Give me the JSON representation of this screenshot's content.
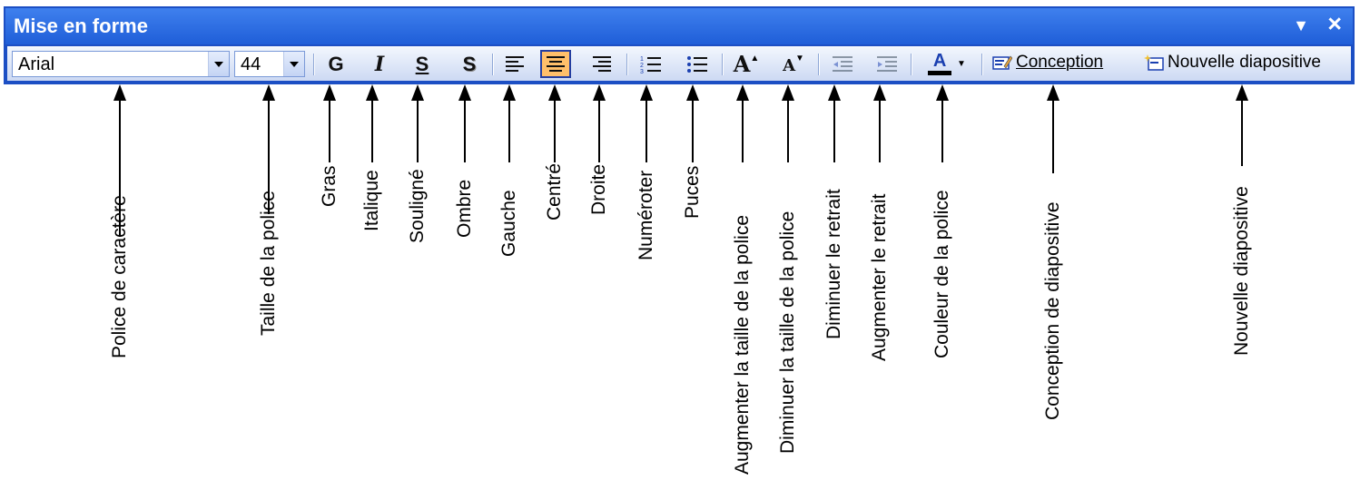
{
  "window": {
    "title": "Mise en forme"
  },
  "toolbar": {
    "font_value": "Arial",
    "size_value": "44",
    "bold_glyph": "G",
    "italic_glyph": "I",
    "underline_glyph": "S",
    "shadow_glyph": "S",
    "grow_glyph": "A",
    "shrink_glyph": "A",
    "color_glyph": "A",
    "color_bar": "#000000",
    "conception_label": "Conception",
    "new_slide_label": "Nouvelle diapositive",
    "active_button": "align-center"
  },
  "annotations": [
    {
      "key": "font",
      "label": "Police de caractère"
    },
    {
      "key": "size",
      "label": "Taille de la police"
    },
    {
      "key": "bold",
      "label": "Gras"
    },
    {
      "key": "italic",
      "label": "Italique"
    },
    {
      "key": "underline",
      "label": "Souligné"
    },
    {
      "key": "shadow",
      "label": "Ombre"
    },
    {
      "key": "left",
      "label": "Gauche"
    },
    {
      "key": "center",
      "label": "Centré"
    },
    {
      "key": "right",
      "label": "Droite"
    },
    {
      "key": "numbering",
      "label": "Numéroter"
    },
    {
      "key": "bullets",
      "label": "Puces"
    },
    {
      "key": "grow",
      "label": "Augmenter la taille de la police"
    },
    {
      "key": "shrink",
      "label": "Diminuer la taille de la police"
    },
    {
      "key": "outdent",
      "label": "Diminuer le retrait"
    },
    {
      "key": "indent",
      "label": "Augmenter le retrait"
    },
    {
      "key": "color",
      "label": "Couleur de la police"
    },
    {
      "key": "design",
      "label": "Conception de diapositive"
    },
    {
      "key": "newslide",
      "label": "Nouvelle diapositive"
    }
  ],
  "colors": {
    "titlebar": "#1f5ed8",
    "active_button": "#ffbf6a"
  }
}
